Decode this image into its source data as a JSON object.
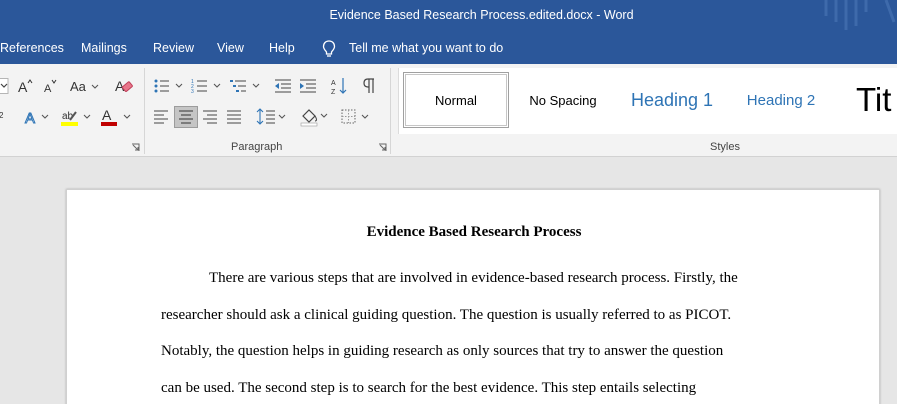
{
  "window": {
    "title": "Evidence Based Research Process.edited.docx  -  Word"
  },
  "menu": {
    "items": [
      "References",
      "Mailings",
      "Review",
      "View",
      "Help"
    ],
    "tell_me": "Tell me what you want to do"
  },
  "ribbon": {
    "font_group": {
      "change_case_label": "Aa"
    },
    "paragraph_group": {
      "label": "Paragraph"
    },
    "styles_group": {
      "label": "Styles",
      "items": [
        "Normal",
        "No Spacing",
        "Heading 1",
        "Heading 2",
        "Tit"
      ],
      "selected": "Normal"
    }
  },
  "document": {
    "heading": "Evidence Based Research Process",
    "lines": [
      "There are various steps that are involved in evidence-based research process. Firstly, the",
      "researcher should ask a clinical guiding question. The question is usually referred to as PICOT.",
      "Notably, the question helps in guiding research as only sources that try to answer the question",
      "can be used. The second step is to search for the best evidence. This step entails selecting"
    ]
  },
  "colors": {
    "title_bar": "#2b579a",
    "ribbon_bg": "#f3f3f3",
    "heading_style": "#2e74b5",
    "font_color_red": "#c00000",
    "highlight_yellow": "#ffff00"
  }
}
